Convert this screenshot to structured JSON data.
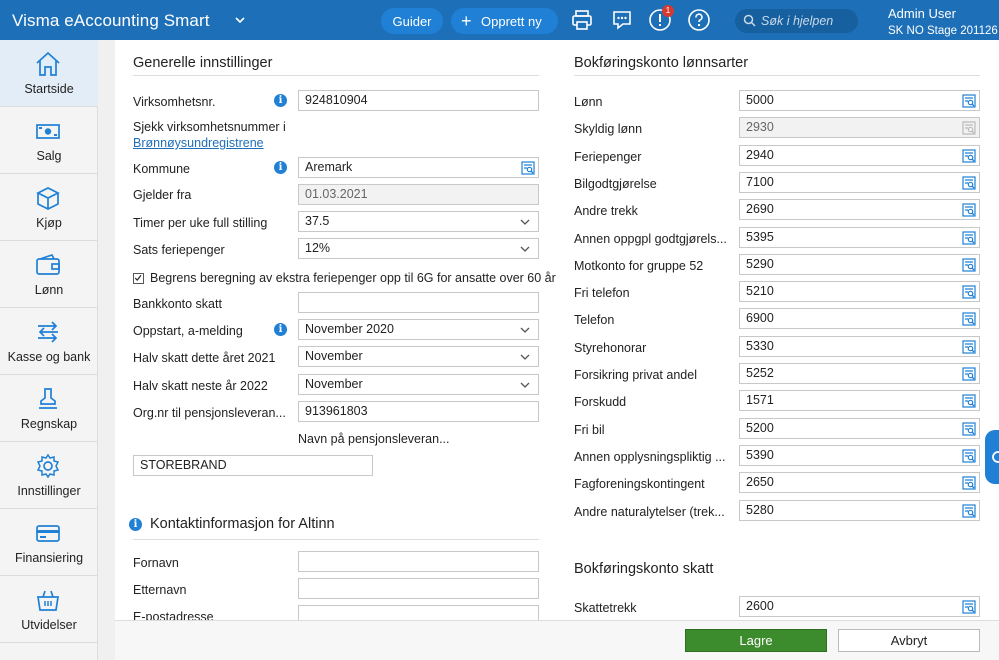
{
  "header": {
    "brand": "Visma eAccounting Smart",
    "guider_label": "Guider",
    "opprett_label": "Opprett ny",
    "notification_count": "1",
    "search_placeholder": "Søk i hjelpen",
    "user_name": "Admin User",
    "company": "SK NO Stage 201126",
    "colors": {
      "bar": "#1d6fb8",
      "accent": "#1f80d6"
    }
  },
  "sidebar": {
    "items": [
      {
        "label": "Startside",
        "icon": "home-icon"
      },
      {
        "label": "Salg",
        "icon": "money-icon"
      },
      {
        "label": "Kjøp",
        "icon": "box-icon"
      },
      {
        "label": "Lønn",
        "icon": "wallet-icon"
      },
      {
        "label": "Kasse og bank",
        "icon": "transfer-icon"
      },
      {
        "label": "Regnskap",
        "icon": "stamp-icon"
      },
      {
        "label": "Innstillinger",
        "icon": "gear-icon"
      },
      {
        "label": "Finansiering",
        "icon": "card-icon"
      },
      {
        "label": "Utvidelser",
        "icon": "basket-icon"
      }
    ]
  },
  "general": {
    "title": "Generelle innstillinger",
    "virksomhetsnr_label": "Virksomhetsnr.",
    "virksomhetsnr_value": "924810904",
    "sjekk_text": "Sjekk virksomhetsnummer i",
    "sjekk_link": "Brønnøysundregistrene",
    "kommune_label": "Kommune",
    "kommune_value": "Aremark",
    "gjelder_label": "Gjelder fra",
    "gjelder_value": "01.03.2021",
    "timer_label": "Timer per uke full stilling",
    "timer_value": "37.5",
    "sats_label": "Sats feriepenger",
    "sats_value": "12%",
    "begrens_label": "Begrens beregning av ekstra feriepenger opp til 6G for ansatte over 60 år",
    "begrens_checked": true,
    "bankkonto_label": "Bankkonto skatt",
    "bankkonto_value": "",
    "oppstart_label": "Oppstart, a-melding",
    "oppstart_value": "November 2020",
    "halv_dette_label": "Halv skatt dette året 2021",
    "halv_dette_value": "November",
    "halv_neste_label": "Halv skatt neste år 2022",
    "halv_neste_value": "November",
    "orgnr_label": "Org.nr til pensjonsleveran...",
    "orgnr_value": "913961803",
    "navn_label": "Navn på pensjonsleveran...",
    "navn_value": "STOREBRAND"
  },
  "altinn": {
    "title": "Kontaktinformasjon for Altinn",
    "fornavn_label": "Fornavn",
    "fornavn_value": "",
    "etternavn_label": "Etternavn",
    "etternavn_value": "",
    "epost_label": "E-postadresse",
    "epost_value": ""
  },
  "lonnsarter": {
    "title": "Bokføringskonto lønnsarter",
    "rows": [
      {
        "label": "Lønn",
        "value": "5000",
        "disabled": false
      },
      {
        "label": "Skyldig lønn",
        "value": "2930",
        "disabled": true
      },
      {
        "label": "Feriepenger",
        "value": "2940",
        "disabled": false
      },
      {
        "label": "Bilgodtgjørelse",
        "value": "7100",
        "disabled": false
      },
      {
        "label": "Andre trekk",
        "value": "2690",
        "disabled": false
      },
      {
        "label": "Annen oppgpl godtgjørels...",
        "value": "5395",
        "disabled": false
      },
      {
        "label": "Motkonto for gruppe 52",
        "value": "5290",
        "disabled": false
      },
      {
        "label": "Fri telefon",
        "value": "5210",
        "disabled": false
      },
      {
        "label": "Telefon",
        "value": "6900",
        "disabled": false
      },
      {
        "label": "Styrehonorar",
        "value": "5330",
        "disabled": false
      },
      {
        "label": "Forsikring privat andel",
        "value": "5252",
        "disabled": false
      },
      {
        "label": "Forskudd",
        "value": "1571",
        "disabled": false
      },
      {
        "label": "Fri bil",
        "value": "5200",
        "disabled": false
      },
      {
        "label": "Annen opplysningspliktig ...",
        "value": "5390",
        "disabled": false
      },
      {
        "label": "Fagforeningskontingent",
        "value": "2650",
        "disabled": false
      },
      {
        "label": "Andre naturalytelser (trek...",
        "value": "5280",
        "disabled": false
      }
    ]
  },
  "skatt": {
    "title": "Bokføringskonto skatt",
    "rows": [
      {
        "label": "Skattetrekk",
        "value": "2600"
      }
    ]
  },
  "footer": {
    "save_label": "Lagre",
    "cancel_label": "Avbryt"
  }
}
